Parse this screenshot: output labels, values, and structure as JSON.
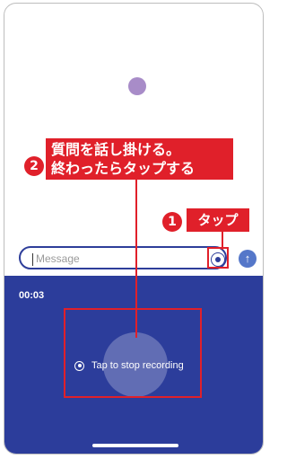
{
  "composer": {
    "placeholder": "Message"
  },
  "recording": {
    "timer": "00:03",
    "stop_label": "Tap to stop recording"
  },
  "annotations": {
    "step1_number": "1",
    "step1_label": "タップ",
    "step2_number": "2",
    "step2_line1": "質問を話し掛ける。",
    "step2_line2": "終わったらタップする"
  },
  "colors": {
    "accent_red": "#e0202a",
    "panel_blue": "#2c3d9b",
    "assistant_dot": "#a88cc8"
  },
  "icons": [
    "voice-mode-icon",
    "send-arrow-icon",
    "stop-recording-icon"
  ]
}
